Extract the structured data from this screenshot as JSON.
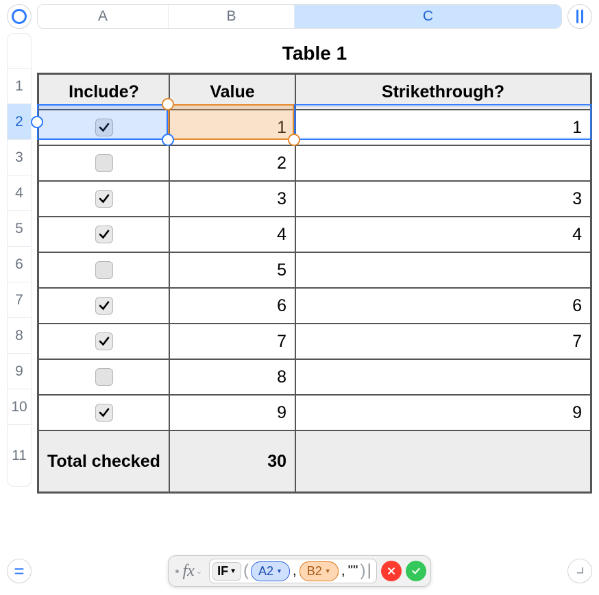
{
  "columns": {
    "a": "A",
    "b": "B",
    "c": "C"
  },
  "rows": [
    "1",
    "2",
    "3",
    "4",
    "5",
    "6",
    "7",
    "8",
    "9",
    "10",
    "11"
  ],
  "table_title": "Table 1",
  "headers": {
    "include": "Include?",
    "value": "Value",
    "strike": "Strikethrough?"
  },
  "data_rows": [
    {
      "checked": true,
      "value": "1",
      "strike": "1"
    },
    {
      "checked": false,
      "value": "2",
      "strike": ""
    },
    {
      "checked": true,
      "value": "3",
      "strike": "3"
    },
    {
      "checked": true,
      "value": "4",
      "strike": "4"
    },
    {
      "checked": false,
      "value": "5",
      "strike": ""
    },
    {
      "checked": true,
      "value": "6",
      "strike": "6"
    },
    {
      "checked": true,
      "value": "7",
      "strike": "7"
    },
    {
      "checked": false,
      "value": "8",
      "strike": ""
    },
    {
      "checked": true,
      "value": "9",
      "strike": "9"
    }
  ],
  "footer": {
    "label": "Total checked",
    "total": "30",
    "strike": ""
  },
  "formula": {
    "fn": "IF",
    "ref1": "A2",
    "ref2": "B2",
    "literal": "\"\"",
    "raw": "IF(A2,B2,\"\")"
  },
  "equals_glyph": "="
}
